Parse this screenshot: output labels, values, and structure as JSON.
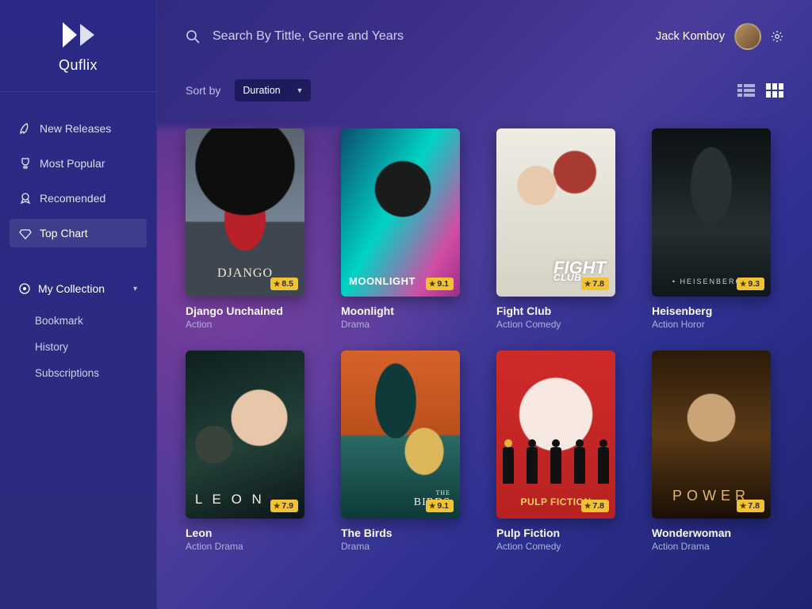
{
  "app": {
    "name": "Quflix"
  },
  "search": {
    "placeholder": "Search By Tittle, Genre and Years"
  },
  "user": {
    "name": "Jack Komboy"
  },
  "sidebar": {
    "nav": [
      {
        "label": "New Releases",
        "icon": "rocket-icon"
      },
      {
        "label": "Most Popular",
        "icon": "trophy-icon"
      },
      {
        "label": "Recomended",
        "icon": "medal-icon"
      },
      {
        "label": "Top Chart",
        "icon": "diamond-icon",
        "active": true
      }
    ],
    "collection_label": "My Collection",
    "subs": [
      {
        "label": "Bookmark"
      },
      {
        "label": "History"
      },
      {
        "label": "Subscriptions"
      }
    ]
  },
  "sort": {
    "label": "Sort by",
    "value": "Duration"
  },
  "movies": [
    {
      "title": "Django Unchained",
      "genre": "Action",
      "rating": "8.5",
      "poster_label": "DJANGO"
    },
    {
      "title": "Moonlight",
      "genre": "Drama",
      "rating": "9.1",
      "poster_label": "MOONLIGHT"
    },
    {
      "title": "Fight Club",
      "genre": "Action Comedy",
      "rating": "7.8",
      "poster_label": "FIGHT",
      "poster_sub": "CLUB"
    },
    {
      "title": "Heisenberg",
      "genre": "Action Horor",
      "rating": "9.3",
      "poster_label": "• HEISENBERG •"
    },
    {
      "title": "Leon",
      "genre": "Action Drama",
      "rating": "7.9",
      "poster_label": "L E O N"
    },
    {
      "title": "The Birds",
      "genre": "Drama",
      "rating": "9.1",
      "poster_label": "BIRDS",
      "poster_sub": "THE"
    },
    {
      "title": "Pulp Fiction",
      "genre": "Action Comedy",
      "rating": "7.8",
      "poster_label": "PULP FICTION"
    },
    {
      "title": "Wonderwoman",
      "genre": "Action Drama",
      "rating": "7.8",
      "poster_label": "POWER"
    }
  ]
}
